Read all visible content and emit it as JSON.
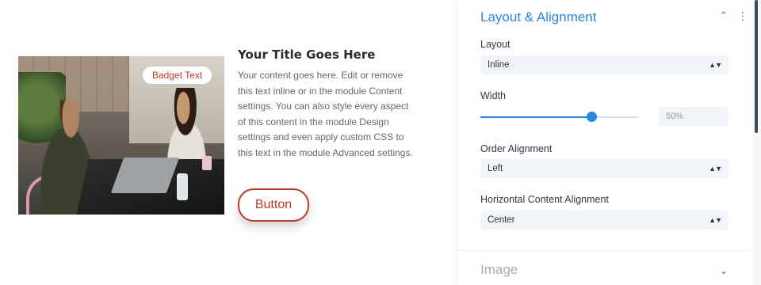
{
  "preview": {
    "badge_text": "Badget Text",
    "title": "Your Title Goes Here",
    "body": "Your content goes here. Edit or remove this text inline or in the module Content settings. You can also style every aspect of this content in the module Design settings and even apply custom CSS to this text in the module Advanced settings.",
    "button_label": "Button"
  },
  "panel": {
    "section_title": "Layout & Alignment",
    "collapse_icon": "chevron-up",
    "more_icon": "vertical-dots",
    "layout": {
      "label": "Layout",
      "value": "Inline"
    },
    "width": {
      "label": "Width",
      "value": "50%",
      "slider_fraction": 0.7
    },
    "order_alignment": {
      "label": "Order Alignment",
      "value": "Left"
    },
    "horizontal_alignment": {
      "label": "Horizontal Content Alignment",
      "value": "Center"
    },
    "next_section": {
      "title": "Image",
      "icon": "chevron-down"
    }
  },
  "colors": {
    "accent_blue": "#2b87da",
    "button_red": "#c0392b",
    "field_bg": "#f1f4f8"
  },
  "select_arrow_glyph": "▲▼",
  "collapse_glyph": "⌃",
  "more_glyph": "⋮",
  "expand_glyph": "⌄"
}
